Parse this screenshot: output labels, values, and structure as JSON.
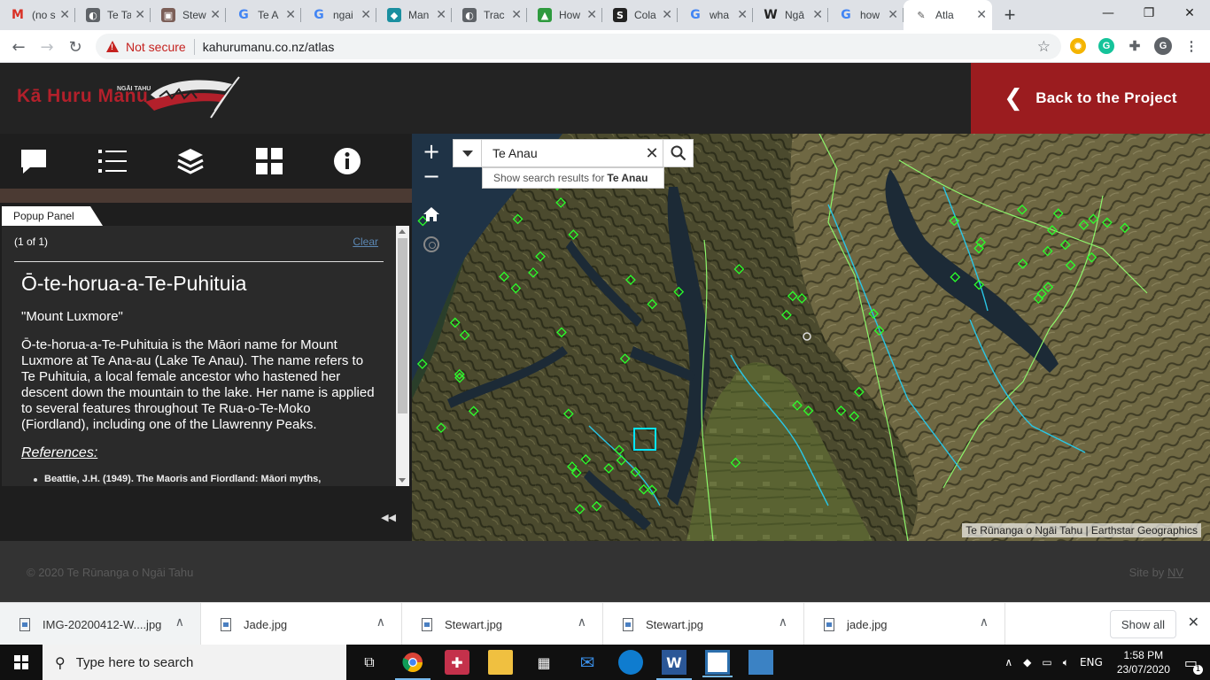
{
  "browser": {
    "tabs": [
      {
        "title": "(no s",
        "icon": "gmail-icon",
        "color": "#d93025",
        "glyph": "M",
        "active": false
      },
      {
        "title": "Te Ta",
        "icon": "globe-icon",
        "color": "#5f6368",
        "glyph": "◐",
        "active": false
      },
      {
        "title": "Stew",
        "icon": "building-icon",
        "color": "#7b5e57",
        "glyph": "▣",
        "active": false
      },
      {
        "title": "Te A",
        "icon": "google-icon",
        "color": "#4285f4",
        "glyph": "G",
        "active": false
      },
      {
        "title": "ngai",
        "icon": "google-icon",
        "color": "#4285f4",
        "glyph": "G",
        "active": false
      },
      {
        "title": "Man",
        "icon": "fish-icon",
        "color": "#1a8fa0",
        "glyph": "◆",
        "active": false
      },
      {
        "title": "Trac",
        "icon": "globe-icon",
        "color": "#5f6368",
        "glyph": "◐",
        "active": false
      },
      {
        "title": "How",
        "icon": "chart-icon",
        "color": "#2e9a3e",
        "glyph": "▲",
        "active": false
      },
      {
        "title": "Cola",
        "icon": "s-icon",
        "color": "#222",
        "glyph": "S",
        "active": false
      },
      {
        "title": "wha",
        "icon": "google-icon",
        "color": "#4285f4",
        "glyph": "G",
        "active": false
      },
      {
        "title": "Ngā",
        "icon": "wikipedia-icon",
        "color": "#222",
        "glyph": "W",
        "active": false
      },
      {
        "title": "how",
        "icon": "google-icon",
        "color": "#4285f4",
        "glyph": "G",
        "active": false
      },
      {
        "title": "Atla",
        "icon": "feather-icon",
        "color": "#555",
        "glyph": "✎",
        "active": true
      }
    ],
    "new_tab": "+",
    "window": {
      "minimize": "—",
      "maximize": "❐",
      "close": "✕"
    },
    "not_secure": "Not secure",
    "url": "kahurumanu.co.nz/atlas",
    "bookmark_star": "☆"
  },
  "site": {
    "logo": "Kā Huru Manu",
    "logo_sub": "NGĀI TAHU",
    "back_button": "Back to the Project",
    "back_chevron": "❮",
    "accent": "#9b1c1f"
  },
  "panel": {
    "tab_label": "Popup Panel",
    "counter": "(1 of 1)",
    "clear": "Clear",
    "title": "Ō-te-horua-a-Te-Puhituia",
    "subtitle": "\"Mount Luxmore\"",
    "description": "Ō-te-horua-a-Te-Puhituia is the Māori name for Mount Luxmore at Te Ana-au (Lake Te Anau). The name refers to Te Puhituia, a local female ancestor who hastened her descent down the mountain to the lake. Her name is applied to several features throughout Te Rua-o-Te-Moko (Fiordland), including one of the Llawrenny Peaks.",
    "references_label": "References:",
    "reference_1": "Beattie, J.H. (1949). The Maoris and Fiordland: Māori myths,",
    "collapse": "◀◀"
  },
  "map": {
    "zoom_in": "+",
    "zoom_out": "−",
    "search_value": "Te Anau",
    "search_clear": "✕",
    "suggestion_prefix": "Show search results for",
    "suggestion_term": "Te Anau",
    "attribution": "Te Rūnanga o Ngāi Tahu | Earthstar Geographics"
  },
  "footer": {
    "copyright": "© 2020 Te Rūnanga o Ngāi Tahu",
    "site_by": "Site by",
    "site_by_link": "NV"
  },
  "downloads": {
    "items": [
      "IMG-20200412-W....jpg",
      "Jade.jpg",
      "Stewart.jpg",
      "Stewart.jpg",
      "jade.jpg"
    ],
    "show_all": "Show all",
    "close": "✕"
  },
  "taskbar": {
    "search_placeholder": "Type here to search",
    "language": "ENG",
    "time": "1:58 PM",
    "date": "23/07/2020",
    "notification_count": "1"
  }
}
